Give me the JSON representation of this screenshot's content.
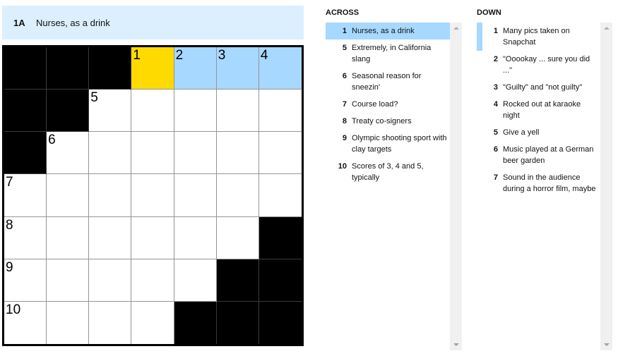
{
  "active_clue": {
    "label": "1A",
    "text": "Nurses, as a drink"
  },
  "grid": {
    "rows": [
      [
        "#",
        "#",
        "#",
        "1",
        "2",
        "3",
        "4"
      ],
      [
        "#",
        "#",
        "5",
        "",
        "",
        "",
        ""
      ],
      [
        "#",
        "6",
        "",
        "",
        "",
        "",
        ""
      ],
      [
        "7",
        "",
        "",
        "",
        "",
        "",
        ""
      ],
      [
        "8",
        "",
        "",
        "",
        "",
        "",
        "#"
      ],
      [
        "9",
        "",
        "",
        "",
        "",
        "#",
        "#"
      ],
      [
        "10",
        "",
        "",
        "",
        "#",
        "#",
        "#"
      ]
    ],
    "selected_cell": [
      0,
      3
    ],
    "highlighted_word": [
      [
        0,
        3
      ],
      [
        0,
        4
      ],
      [
        0,
        5
      ],
      [
        0,
        6
      ]
    ],
    "colors": {
      "selected": "#ffda00",
      "word": "#a7d8ff",
      "clue_bar": "#dcefff"
    }
  },
  "across": {
    "title": "ACROSS",
    "clues": [
      {
        "num": "1",
        "text": "Nurses, as a drink",
        "state": "active"
      },
      {
        "num": "5",
        "text": "Extremely, in California slang",
        "state": ""
      },
      {
        "num": "6",
        "text": "Seasonal reason for sneezin'",
        "state": ""
      },
      {
        "num": "7",
        "text": "Course load?",
        "state": ""
      },
      {
        "num": "8",
        "text": "Treaty co-signers",
        "state": ""
      },
      {
        "num": "9",
        "text": "Olympic shooting sport with clay targets",
        "state": ""
      },
      {
        "num": "10",
        "text": "Scores of 3, 4 and 5, typically",
        "state": ""
      }
    ]
  },
  "down": {
    "title": "DOWN",
    "clues": [
      {
        "num": "1",
        "text": "Many pics taken on Snapchat",
        "state": "crossing"
      },
      {
        "num": "2",
        "text": "\"Ooookay ... sure you did ...\"",
        "state": ""
      },
      {
        "num": "3",
        "text": "\"Guilty\" and \"not guilty\"",
        "state": ""
      },
      {
        "num": "4",
        "text": "Rocked out at karaoke night",
        "state": ""
      },
      {
        "num": "5",
        "text": "Give a yell",
        "state": ""
      },
      {
        "num": "6",
        "text": "Music played at a German beer garden",
        "state": ""
      },
      {
        "num": "7",
        "text": "Sound in the audience during a horror film, maybe",
        "state": ""
      }
    ]
  }
}
